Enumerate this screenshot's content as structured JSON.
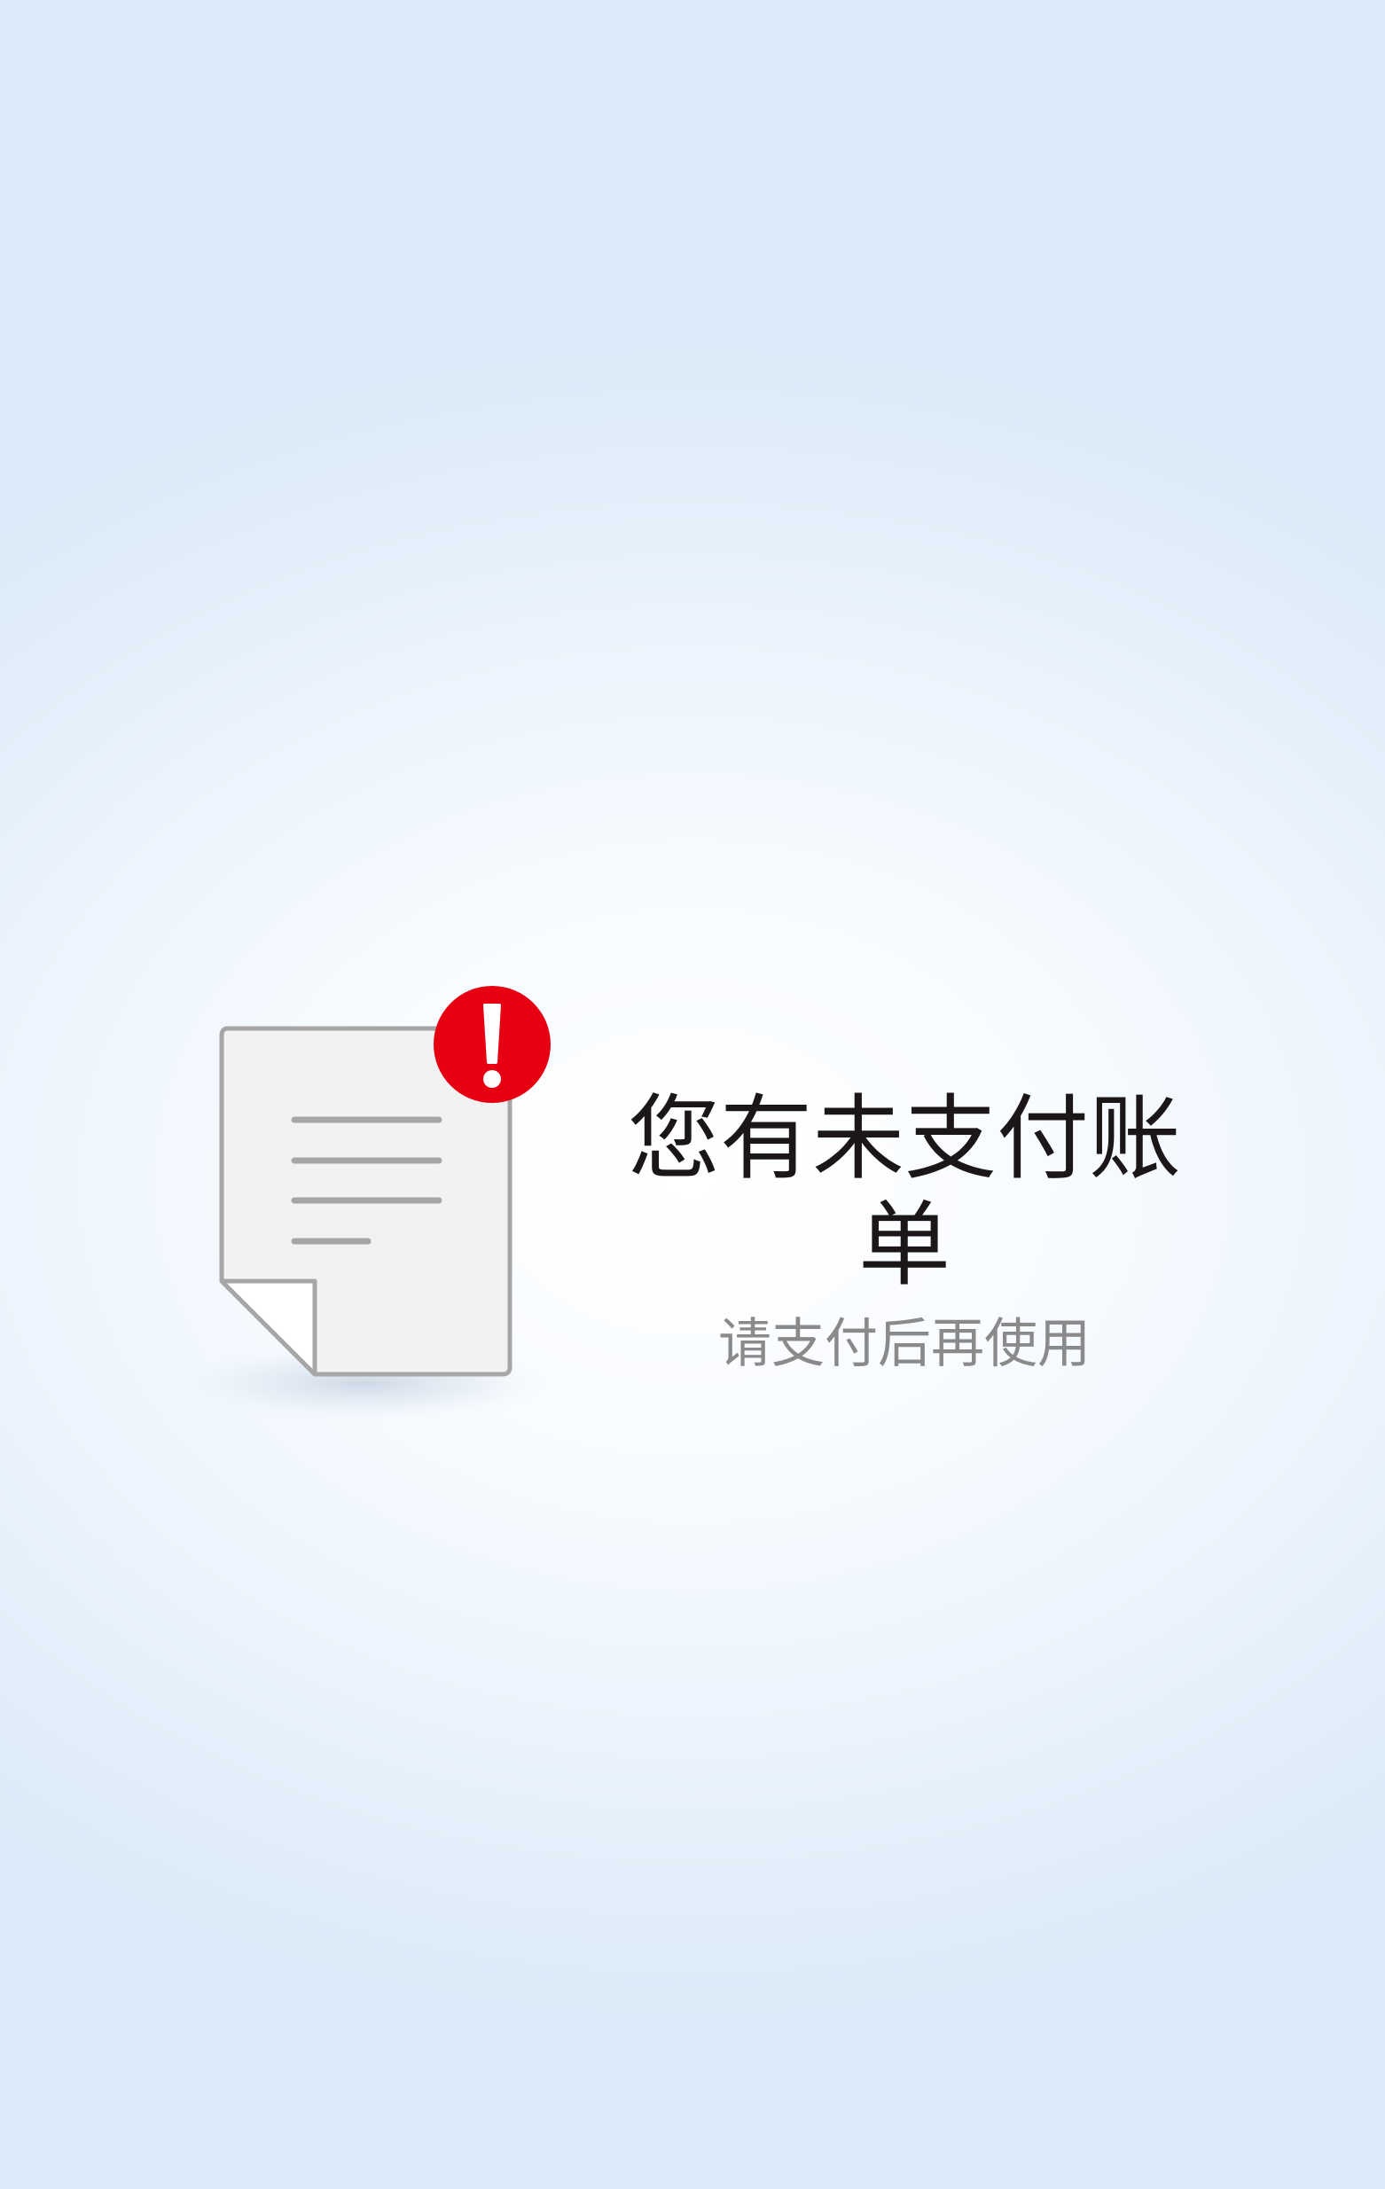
{
  "notice": {
    "title": "您有未支付账单",
    "subtitle": "请支付后再使用",
    "icon": "unpaid-bill-document-icon",
    "badge_icon": "exclamation-alert-icon"
  },
  "colors": {
    "background_center": "#ffffff",
    "background_edge": "#dbe9f8",
    "title_text": "#1b1718",
    "subtitle_text": "#8a8a8a",
    "alert_red": "#e60012",
    "document_fill": "#f2f2f2",
    "document_stroke": "#a6a6a6"
  }
}
